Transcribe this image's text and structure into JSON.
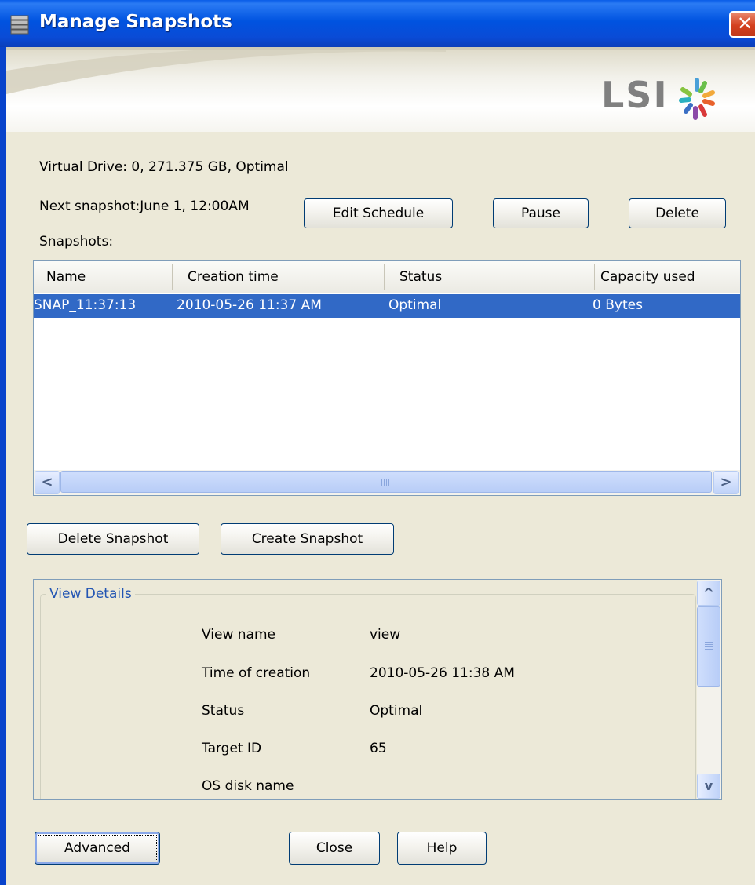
{
  "window": {
    "title": "Manage Snapshots",
    "close_glyph": "✕",
    "icon": "storage-stack-icon"
  },
  "logo": {
    "text": "LSI",
    "icon": "lsi-star-logo"
  },
  "info": {
    "virtual_drive": "Virtual Drive: 0, 271.375 GB, Optimal",
    "next_snapshot": "Next snapshot:June 1, 12:00AM",
    "snapshots_label": "Snapshots:"
  },
  "schedule_buttons": {
    "edit": "Edit Schedule",
    "pause": "Pause",
    "delete": "Delete"
  },
  "table": {
    "columns": [
      "Name",
      "Creation time",
      "Status",
      "Capacity used"
    ],
    "rows": [
      {
        "name": "SNAP_11:37:13",
        "creation_time": "2010-05-26 11:37 AM",
        "status": "Optimal",
        "capacity": "0 Bytes",
        "selected": true
      }
    ],
    "scroll": {
      "left": "<",
      "right": ">"
    }
  },
  "snapshot_buttons": {
    "delete": "Delete Snapshot",
    "create": "Create Snapshot"
  },
  "details": {
    "title": "View Details",
    "fields": [
      {
        "label": "View name",
        "value": "view"
      },
      {
        "label": "Time of creation",
        "value": "2010-05-26 11:38 AM"
      },
      {
        "label": "Status",
        "value": "Optimal"
      },
      {
        "label": "Target ID",
        "value": "65"
      },
      {
        "label": "OS disk name",
        "value": ""
      }
    ],
    "scroll": {
      "up": "^",
      "down": "v"
    }
  },
  "footer": {
    "advanced": "Advanced",
    "close": "Close",
    "help": "Help"
  },
  "colors": {
    "titlebar": "#0053e0",
    "selection": "#3169c6",
    "dialog_bg": "#ece9d8",
    "group_title": "#2255b3"
  }
}
